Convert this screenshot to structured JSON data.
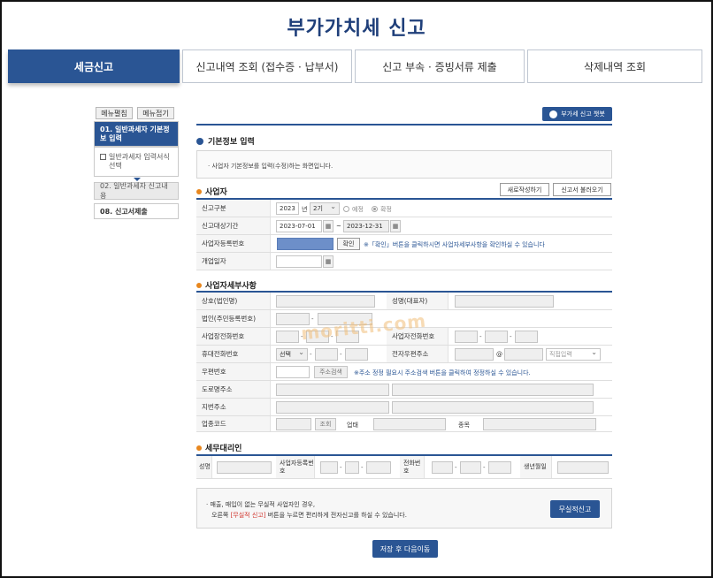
{
  "page": {
    "title": "부가가치세 신고"
  },
  "tabs": [
    {
      "label": "세금신고",
      "active": true
    },
    {
      "label": "신고내역 조회 (접수증 · 납부서)",
      "active": false
    },
    {
      "label": "신고 부속 · 증빙서류 제출",
      "active": false
    },
    {
      "label": "삭제내역 조회",
      "active": false
    }
  ],
  "sidebar": {
    "expand_label": "메뉴펼침",
    "collapse_label": "메뉴접기",
    "steps": [
      {
        "label": "01. 일반과세자 기본정보 입력"
      },
      {
        "label": "일반과세자 입력서식 선택"
      },
      {
        "label": "02. 일반과세자 신고내용"
      },
      {
        "label": "08. 신고서제출"
      }
    ]
  },
  "chatbot": {
    "label": "부가세 신고 챗봇"
  },
  "basic_info": {
    "section_title": "기본정보 입력",
    "notice": "· 사업자 기본정보를 입력(수정)하는 화면입니다."
  },
  "business": {
    "section_title": "사업자",
    "new_button": "새로작성하기",
    "load_button": "신고서 불러오기",
    "labels": {
      "report_type": "신고구분",
      "period": "신고대상기간",
      "biz_no": "사업자등록번호",
      "open_date": "개업일자"
    },
    "year": "2023",
    "year_unit": "년",
    "term": "2기",
    "radio_prelim": "예정",
    "radio_final": "확정",
    "start_date": "2023-07-01",
    "end_date": "2023-12-31",
    "tilde": "~",
    "confirm_button": "확인",
    "biz_note": "※「확인」버튼을 클릭하시면 사업자세부사항을 확인하실 수 있습니다"
  },
  "details": {
    "section_title": "사업자세부사항",
    "labels": {
      "company_name": "상호(법인명)",
      "ceo_name": "성명(대표자)",
      "corp_no": "법인(주민등록번호)",
      "biz_phone": "사업장전화번호",
      "owner_phone": "사업자전화번호",
      "mobile": "휴대전화번호",
      "email": "전자우편주소",
      "zip": "우편번호",
      "road_addr": "도로명주소",
      "lot_addr": "지번주소",
      "industry_code": "업종코드",
      "biz_type": "업태",
      "biz_item": "종목"
    },
    "mobile_select": "선택",
    "email_domain": "직접입력",
    "at": "@",
    "zip_search": "주소검색",
    "zip_note": "※주소 정정 필요시 주소검색 버튼을 클릭하여 정정하실 수 있습니다.",
    "lookup_button": "조회"
  },
  "agent": {
    "section_title": "세무대리인",
    "labels": {
      "name": "성명",
      "biz_no": "사업자등록번호",
      "phone": "전화번호",
      "birth": "생년월일"
    }
  },
  "bottom": {
    "line1": "· 매출, 매입이 없는 무실적 사업자인 경우,",
    "line2_prefix": "오른쪽",
    "line2_highlight": "[무실적 신고]",
    "line2_suffix": "버튼을 누르면 편리하게 전자신고를 하실 수 있습니다.",
    "no_perf_button": "무실적신고",
    "save_next_button": "저장 후 다음이동"
  },
  "watermark": "moritti.com",
  "colors": {
    "primary": "#2a5594",
    "accent_orange": "#e8871e",
    "highlight_red": "#d0342c"
  }
}
